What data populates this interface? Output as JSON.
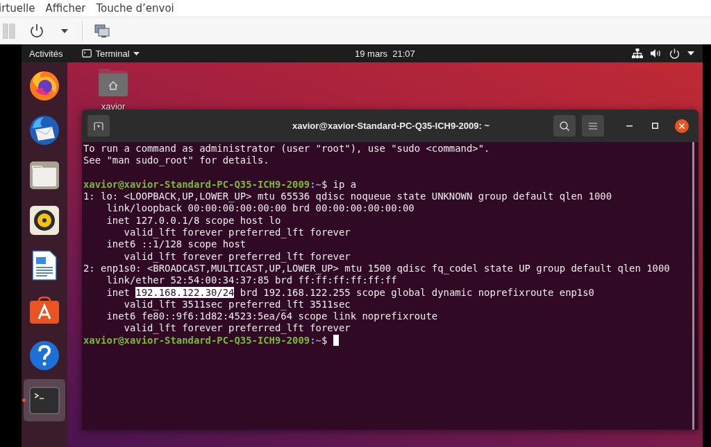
{
  "host_menu": [
    "irtuelle",
    "Afficher",
    "Touche d’envoi"
  ],
  "topbar": {
    "activities": "Activités",
    "app_menu": "Terminal",
    "clock": "19 mars  21:07"
  },
  "dock": [
    {
      "kind": "firefox",
      "selected": false,
      "running": false
    },
    {
      "kind": "mail",
      "selected": false,
      "running": false
    },
    {
      "kind": "files",
      "selected": false,
      "running": false
    },
    {
      "kind": "music",
      "selected": false,
      "running": false
    },
    {
      "kind": "writer",
      "selected": false,
      "running": false
    },
    {
      "kind": "software",
      "selected": false,
      "running": false
    },
    {
      "kind": "help",
      "selected": false,
      "running": false
    },
    {
      "kind": "terminal",
      "selected": true,
      "running": true
    }
  ],
  "desktop_icons": [
    {
      "label": "xavior"
    }
  ],
  "terminal": {
    "title": "xavior@xavior-Standard-PC-Q35-ICH9-2009: ~",
    "lines": [
      {
        "kind": "text",
        "text": "To run a command as administrator (user \"root\"), use \"sudo <command>\"."
      },
      {
        "kind": "text",
        "text": "See \"man sudo_root\" for details."
      },
      {
        "kind": "prompt",
        "gap_before": true,
        "user": "xavior@xavior-Standard-PC-Q35-ICH9-2009",
        "path": ":~",
        "command": "$ ip a",
        "cursor": false
      },
      {
        "kind": "text",
        "text": "1: lo: <LOOPBACK,UP,LOWER_UP> mtu 65536 qdisc noqueue state UNKNOWN group default qlen 1000"
      },
      {
        "kind": "text",
        "text": "    link/loopback 00:00:00:00:00:00 brd 00:00:00:00:00:00"
      },
      {
        "kind": "text",
        "text": "    inet 127.0.0.1/8 scope host lo"
      },
      {
        "kind": "text",
        "text": "       valid_lft forever preferred_lft forever"
      },
      {
        "kind": "text",
        "text": "    inet6 ::1/128 scope host"
      },
      {
        "kind": "text",
        "text": "       valid_lft forever preferred_lft forever"
      },
      {
        "kind": "text",
        "text": "2: enp1s0: <BROADCAST,MULTICAST,UP,LOWER_UP> mtu 1500 qdisc fq_codel state UP group default qlen 1000"
      },
      {
        "kind": "text",
        "text": "    link/ether 52:54:00:34:37:85 brd ff:ff:ff:ff:ff:ff"
      },
      {
        "kind": "parts",
        "parts": [
          {
            "text": "    inet ",
            "selected": false
          },
          {
            "text": "192.168.122.30/24",
            "selected": true
          },
          {
            "text": " brd 192.168.122.255 scope global dynamic noprefixroute enp1s0",
            "selected": false
          }
        ]
      },
      {
        "kind": "text",
        "text": "       valid_lft 3511sec preferred_lft 3511sec"
      },
      {
        "kind": "text",
        "text": "    inet6 fe80::9f6:1d82:4523:5ea/64 scope link noprefixroute"
      },
      {
        "kind": "text",
        "text": "       valid_lft forever preferred_lft forever"
      },
      {
        "kind": "prompt",
        "gap_before": false,
        "user": "xavior@xavior-Standard-PC-Q35-ICH9-2009",
        "path": ":~",
        "command": "$ ",
        "cursor": true
      }
    ]
  }
}
